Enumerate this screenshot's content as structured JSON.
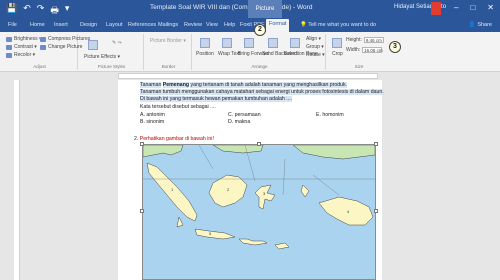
{
  "window": {
    "title": "Template Soal WIR VIII dan (Compatibility Mode) - Word",
    "context_tab_group": "Picture Tools",
    "user": "Hidayat Setiadianto",
    "controls": [
      "–",
      "□",
      "✕"
    ]
  },
  "quick_access": [
    "💾",
    "↶",
    "↷",
    "🖶",
    "▾"
  ],
  "tabs": [
    "File",
    "Home",
    "Insert",
    "Design",
    "Layout",
    "References",
    "Mailings",
    "Review",
    "View",
    "Help",
    "Foxit PDF",
    "Format"
  ],
  "active_tab": "Format",
  "tell_me": "Tell me what you want to do",
  "share": "Share",
  "ribbon": {
    "adjust": {
      "items": [
        "Brightness ▾",
        "Contrast ▾",
        "Recolor ▾"
      ],
      "items2": [
        "Compress Pictures",
        "Change Picture",
        "Reset Picture ▾"
      ],
      "label": "Adjust"
    },
    "styles": {
      "items": [
        "Picture Effects ▾",
        "Picture Layout ▾"
      ],
      "label": "Picture Styles"
    },
    "border": {
      "items": [
        "Picture Border ▾"
      ],
      "label": "Border"
    },
    "arrange": {
      "items": [
        "Position",
        "Wrap Text",
        "Bring Forward",
        "Send Backward",
        "Selection Pane",
        "Align ▾",
        "Group ▾",
        "Rotate ▾"
      ],
      "label": "Arrange"
    },
    "size": {
      "crop": "Crop",
      "height_label": "Height:",
      "height_value": "9.46 cm",
      "width_label": "Width:",
      "width_value": "16.06 cm",
      "label": "Size"
    }
  },
  "callouts": [
    "2",
    "3",
    "1"
  ],
  "document": {
    "para_line1_pre": "Tanaman",
    "para_word": "Pemenang",
    "para_line1_post": "yang tertanam di tanah adalah tanaman yang menghasilkan produk.",
    "para_line2": "Tanaman tumbuh menggunakan cahaya matahari sebagai energi untuk proses fotosintesis di dalam daun.",
    "para_line3": "Di bawah ini yang termasuk hewan pemakan tumbuhan adalah ....",
    "question_stem": "Kata tersebut disebut sebagai ....",
    "options": [
      "A. antonim",
      "C. persamaan",
      "E. homonim",
      "B. sinonim",
      "D. makna"
    ],
    "question2_number": "2.",
    "question2": "Perhatikan gambar di bawah ini!",
    "map_label": "peta Indonesia"
  }
}
